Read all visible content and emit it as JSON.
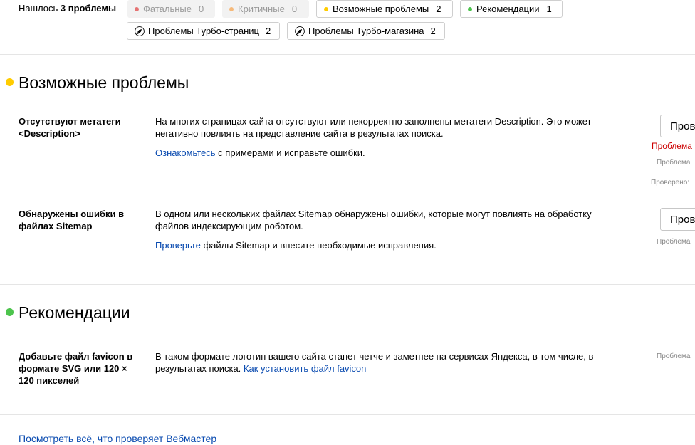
{
  "summary": {
    "prefix": "Нашлось",
    "count_text": "3 проблемы"
  },
  "filters": [
    {
      "label": "Фатальные",
      "count": "0",
      "color": "#e57373",
      "enabled": false
    },
    {
      "label": "Критичные",
      "count": "0",
      "color": "#f5b97a",
      "enabled": false
    },
    {
      "label": "Возможные проблемы",
      "count": "2",
      "color": "#ffcc00",
      "enabled": true
    },
    {
      "label": "Рекомендации",
      "count": "1",
      "color": "#4cc44c",
      "enabled": true
    }
  ],
  "turbo_filters": [
    {
      "label": "Проблемы Турбо-страниц",
      "count": "2",
      "icon": "rocket-icon"
    },
    {
      "label": "Проблемы Турбо-магазина",
      "count": "2",
      "icon": "rocket-icon"
    }
  ],
  "sections": [
    {
      "title": "Возможные проблемы",
      "color": "#ffcc00",
      "issues": [
        {
          "title": "Отсутствуют метатеги <Description>",
          "description": "На многих страницах сайта отсутствуют или некорректно заполнены метатеги Description. Это может негативно повлиять на представление сайта в результатах поиска.",
          "action_link": "Ознакомьтесь",
          "action_rest": " с примерами и исправьте ошибки.",
          "button_label": "Пров",
          "status_red": "Проблема",
          "status_gray": "Проблема",
          "status_checked": "Проверено:"
        },
        {
          "title": "Обнаружены ошибки в файлах Sitemap",
          "description": "В одном или нескольких файлах Sitemap обнаружены ошибки, которые могут повлиять на обработку файлов индексирующим роботом.",
          "action_link": "Проверьте",
          "action_rest": " файлы Sitemap и внесите необходимые исправления.",
          "button_label": "Пров",
          "status_gray": "Проблема"
        }
      ]
    },
    {
      "title": "Рекомендации",
      "color": "#4cc44c",
      "issues": [
        {
          "title": "Добавьте файл favicon в формате SVG или 120 × 120 пикселей",
          "description": "В таком формате логотип вашего сайта станет четче и заметнее на сервисах Яндекса, в том числе, в результатах поиска. ",
          "description_link": "Как установить файл favicon",
          "status_gray": "Проблема"
        }
      ]
    }
  ],
  "footer_link": "Посмотреть всё, что проверяет Вебмастер"
}
